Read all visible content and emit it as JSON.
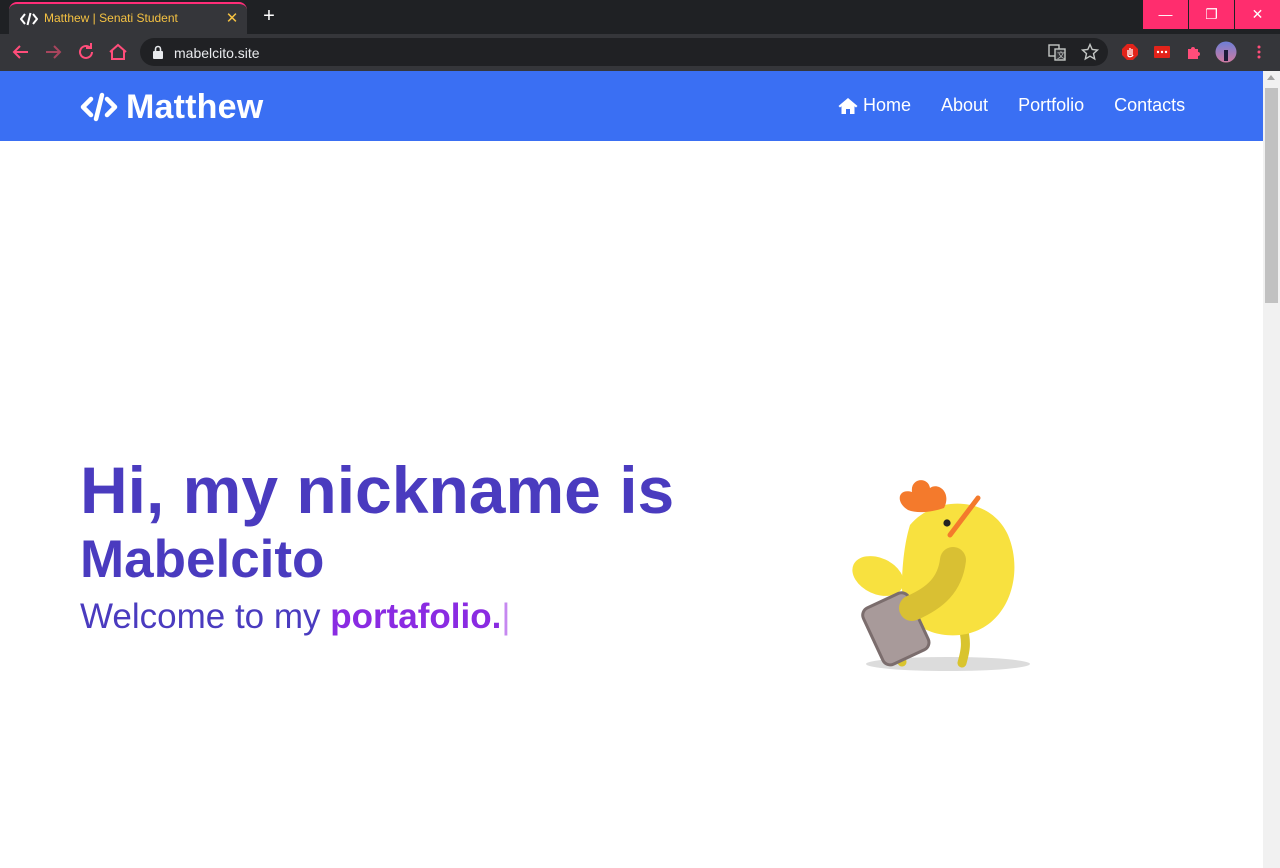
{
  "browser": {
    "tab_title": "Matthew | Senati Student",
    "tab_close": "✕",
    "new_tab": "+",
    "url": "mabelcito.site",
    "window_controls": {
      "minimize": "—",
      "maximize": "❐",
      "close": "✕"
    },
    "accent_color": "#ff2d78",
    "icons": [
      "back-icon",
      "forward-icon",
      "reload-icon",
      "home-icon",
      "lock-icon",
      "translate-icon",
      "star-icon",
      "adblock-icon",
      "extension-red-icon",
      "puzzle-icon",
      "profile-avatar",
      "menu-dots-icon"
    ]
  },
  "navbar": {
    "brand": "Matthew",
    "brand_icon": "code-icon",
    "background": "#3a6ff3",
    "links": [
      {
        "label": "Home",
        "icon": "home-icon"
      },
      {
        "label": "About"
      },
      {
        "label": "Portfolio"
      },
      {
        "label": "Contacts"
      }
    ]
  },
  "hero": {
    "line1": "Hi, my nickname is",
    "line2": "Mabelcito",
    "line3_prefix": "Welcome to my ",
    "line3_highlight": "portafolio.",
    "cursor": "|",
    "text_color": "#4a3bbf",
    "highlight_color": "#8a2be2",
    "illustration": "walking-chick-with-briefcase"
  }
}
